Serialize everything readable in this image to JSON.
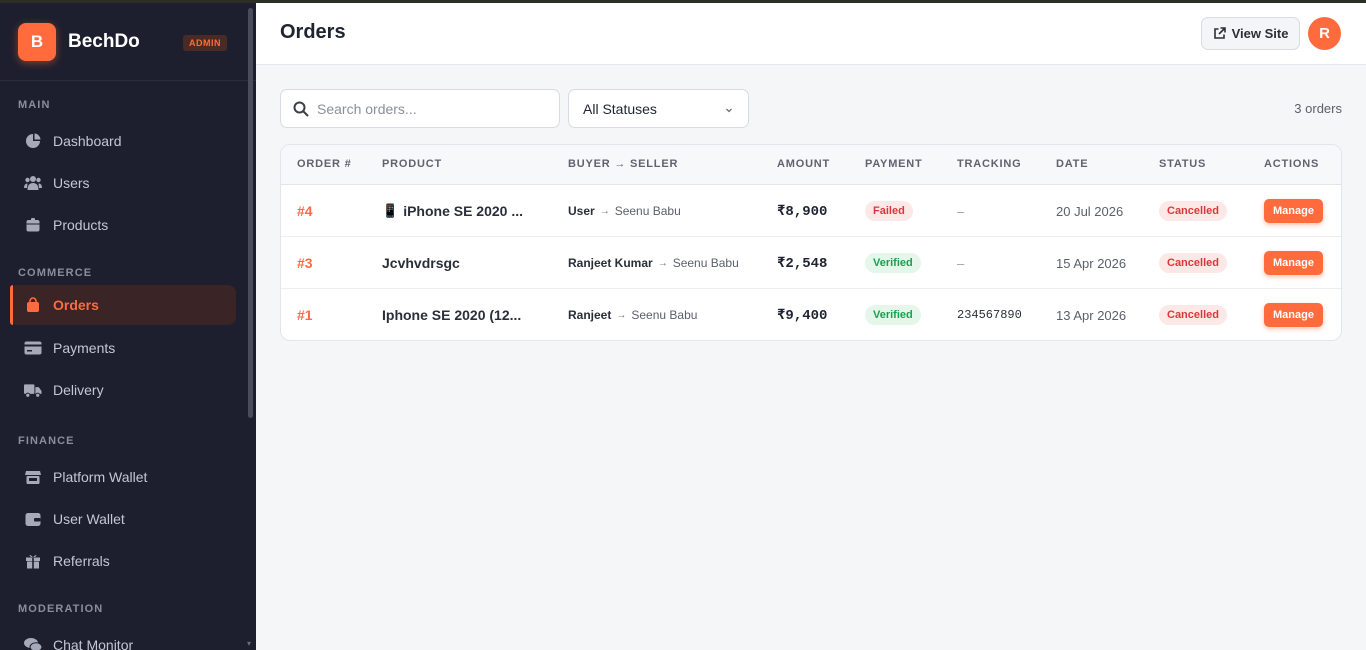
{
  "brand": {
    "logo_letter": "B",
    "name": "BechDo",
    "badge": "ADMIN"
  },
  "sidebar": {
    "sections": [
      {
        "label": "MAIN",
        "items": [
          {
            "label": "Dashboard",
            "icon": "pie-chart-icon"
          },
          {
            "label": "Users",
            "icon": "users-icon"
          },
          {
            "label": "Products",
            "icon": "box-icon"
          }
        ]
      },
      {
        "label": "COMMERCE",
        "items": [
          {
            "label": "Orders",
            "icon": "shopping-bag-icon",
            "active": true
          },
          {
            "label": "Payments",
            "icon": "credit-card-icon"
          },
          {
            "label": "Delivery",
            "icon": "truck-icon"
          }
        ]
      },
      {
        "label": "FINANCE",
        "items": [
          {
            "label": "Platform Wallet",
            "icon": "store-icon"
          },
          {
            "label": "User Wallet",
            "icon": "wallet-icon"
          },
          {
            "label": "Referrals",
            "icon": "gift-icon"
          }
        ]
      },
      {
        "label": "MODERATION",
        "items": [
          {
            "label": "Chat Monitor",
            "icon": "chat-icon"
          }
        ]
      }
    ]
  },
  "header": {
    "title": "Orders",
    "view_site_label": "View Site",
    "avatar_letter": "R"
  },
  "filters": {
    "search_placeholder": "Search orders...",
    "status_selected": "All Statuses",
    "orders_count": "3 orders"
  },
  "table": {
    "columns": [
      "ORDER #",
      "PRODUCT",
      "BUYER → SELLER",
      "AMOUNT",
      "PAYMENT",
      "TRACKING",
      "DATE",
      "STATUS",
      "ACTIONS"
    ],
    "rows": [
      {
        "id": "#4",
        "product_icon": "📱",
        "product": "iPhone SE 2020 ...",
        "buyer": "User",
        "arrow": "→",
        "seller": "Seenu Babu",
        "amount": "₹8,900",
        "payment": "Failed",
        "payment_type": "failed",
        "tracking": "–",
        "date": "20 Jul 2026",
        "status": "Cancelled",
        "action": "Manage"
      },
      {
        "id": "#3",
        "product_icon": "",
        "product": "Jcvhvdrsgc",
        "buyer": "Ranjeet Kumar",
        "arrow": "→",
        "seller": "Seenu Babu",
        "amount": "₹2,548",
        "payment": "Verified",
        "payment_type": "verified",
        "tracking": "–",
        "date": "15 Apr 2026",
        "status": "Cancelled",
        "action": "Manage"
      },
      {
        "id": "#1",
        "product_icon": "",
        "product": "Iphone SE 2020 (12...",
        "buyer": "Ranjeet",
        "arrow": "→",
        "seller": "Seenu Babu",
        "amount": "₹9,400",
        "payment": "Verified",
        "payment_type": "verified",
        "tracking": "234567890",
        "date": "13 Apr 2026",
        "status": "Cancelled",
        "action": "Manage"
      }
    ]
  },
  "colors": {
    "accent": "#ff6b3d",
    "sidebar_bg": "#1e1f2e",
    "failed": "#d9383a",
    "verified": "#1f9d4f"
  }
}
